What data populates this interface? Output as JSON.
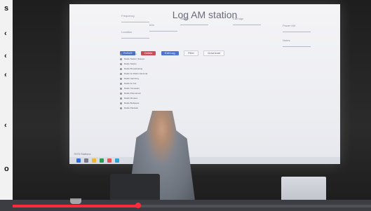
{
  "video_ui": {
    "progress_fraction": 0.35
  },
  "left_strip": {
    "glyphs": [
      "s",
      "‹",
      "‹",
      "‹",
      "‹",
      "o"
    ]
  },
  "screen": {
    "title": "Log AM station",
    "field_labels": [
      "Frequency",
      "kHz",
      "Station",
      "Call sign",
      "Location",
      "Power kW",
      "Notes"
    ],
    "buttons": [
      "Submit",
      "Delete",
      "Edit Log",
      "Filter",
      "Download"
    ],
    "log_items": [
      "Radio Station",
      "Radio Station (Korea)",
      "Radio Station",
      "Radio Broadcasting",
      "Radio de Radio Nacional",
      "Radio Hamburg",
      "Radio de Sur",
      "Radio Yanuwatu",
      "Radio Rhemacom",
      "Radio Monaco",
      "Radio Budapest",
      "Radio Pakistan"
    ],
    "status_text": "7875 Stations"
  }
}
